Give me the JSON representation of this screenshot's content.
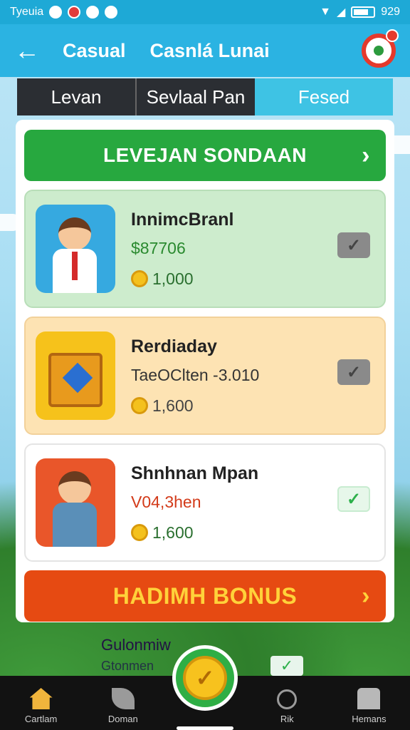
{
  "status": {
    "left_text": "Tyeuia",
    "time": "929"
  },
  "appbar": {
    "title": "Casual",
    "subtitle": "Casnlá Lunai"
  },
  "tabs": [
    {
      "label": "Levan"
    },
    {
      "label": "Sevlaal Pan"
    },
    {
      "label": "Fesed"
    }
  ],
  "banner": {
    "label": "LEVEJAN SONDAAN"
  },
  "cards": [
    {
      "name": "InnimcBranl",
      "price": "$87706",
      "coins": "1,000"
    },
    {
      "name": "Rerdiaday",
      "price": "TaeOClten -3.010",
      "coins": "1,600"
    },
    {
      "name": "Shnhnan Mpan",
      "price": "V04,3hen",
      "coins": "1,600"
    }
  ],
  "bonus": {
    "label": "HADIMH BONUS"
  },
  "peek": {
    "title": "Gulonmiw",
    "subtitle": "Gtonmen"
  },
  "nav": [
    {
      "label": "Cartlam",
      "icon": "home-icon"
    },
    {
      "label": "Doman",
      "icon": "leaf-icon"
    },
    {
      "label": "Rik",
      "icon": "search-person-icon"
    },
    {
      "label": "Hemans",
      "icon": "group-icon"
    }
  ],
  "colors": {
    "primary": "#2bb3e2",
    "green": "#27a83f",
    "orange": "#e64a12",
    "gold": "#f4c11d"
  }
}
